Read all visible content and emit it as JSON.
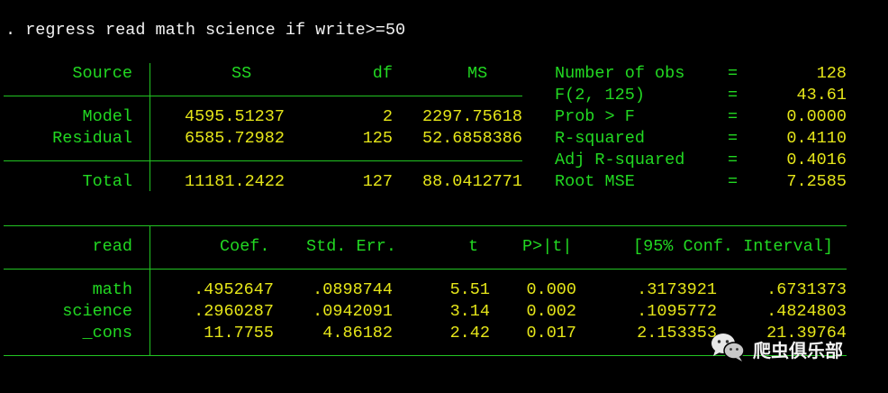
{
  "command": ". regress read math science if write>=50",
  "anova": {
    "headers": {
      "source": "Source",
      "ss": "SS",
      "df": "df",
      "ms": "MS"
    },
    "rows": [
      {
        "source": "Model",
        "ss": "4595.51237",
        "df": "2",
        "ms": "2297.75618"
      },
      {
        "source": "Residual",
        "ss": "6585.72982",
        "df": "125",
        "ms": "52.6858386"
      }
    ],
    "total": {
      "source": "Total",
      "ss": "11181.2422",
      "df": "127",
      "ms": "88.0412771"
    }
  },
  "stats": [
    {
      "label": "Number of obs",
      "eq": "=",
      "value": "128"
    },
    {
      "label": "F(2, 125)",
      "eq": "=",
      "value": "43.61"
    },
    {
      "label": "Prob > F",
      "eq": "=",
      "value": "0.0000"
    },
    {
      "label": "R-squared",
      "eq": "=",
      "value": "0.4110"
    },
    {
      "label": "Adj R-squared",
      "eq": "=",
      "value": "0.4016"
    },
    {
      "label": "Root MSE",
      "eq": "=",
      "value": "7.2585"
    }
  ],
  "coef_table": {
    "headers": {
      "var": "read",
      "coef": "Coef.",
      "se": "Std. Err.",
      "t": "t",
      "p": "P>|t|",
      "ci": "[95% Conf. Interval]"
    },
    "rows": [
      {
        "var": "math",
        "coef": ".4952647",
        "se": ".0898744",
        "t": "5.51",
        "p": "0.000",
        "lo": ".3173921",
        "hi": ".6731373"
      },
      {
        "var": "science",
        "coef": ".2960287",
        "se": ".0942091",
        "t": "3.14",
        "p": "0.002",
        "lo": ".1095772",
        "hi": ".4824803"
      },
      {
        "var": "_cons",
        "coef": "11.7755",
        "se": "4.86182",
        "t": "2.42",
        "p": "0.017",
        "lo": "2.153353",
        "hi": "21.39764"
      }
    ]
  },
  "watermark": {
    "text": "爬虫俱乐部",
    "icon": "wechat-icon"
  }
}
